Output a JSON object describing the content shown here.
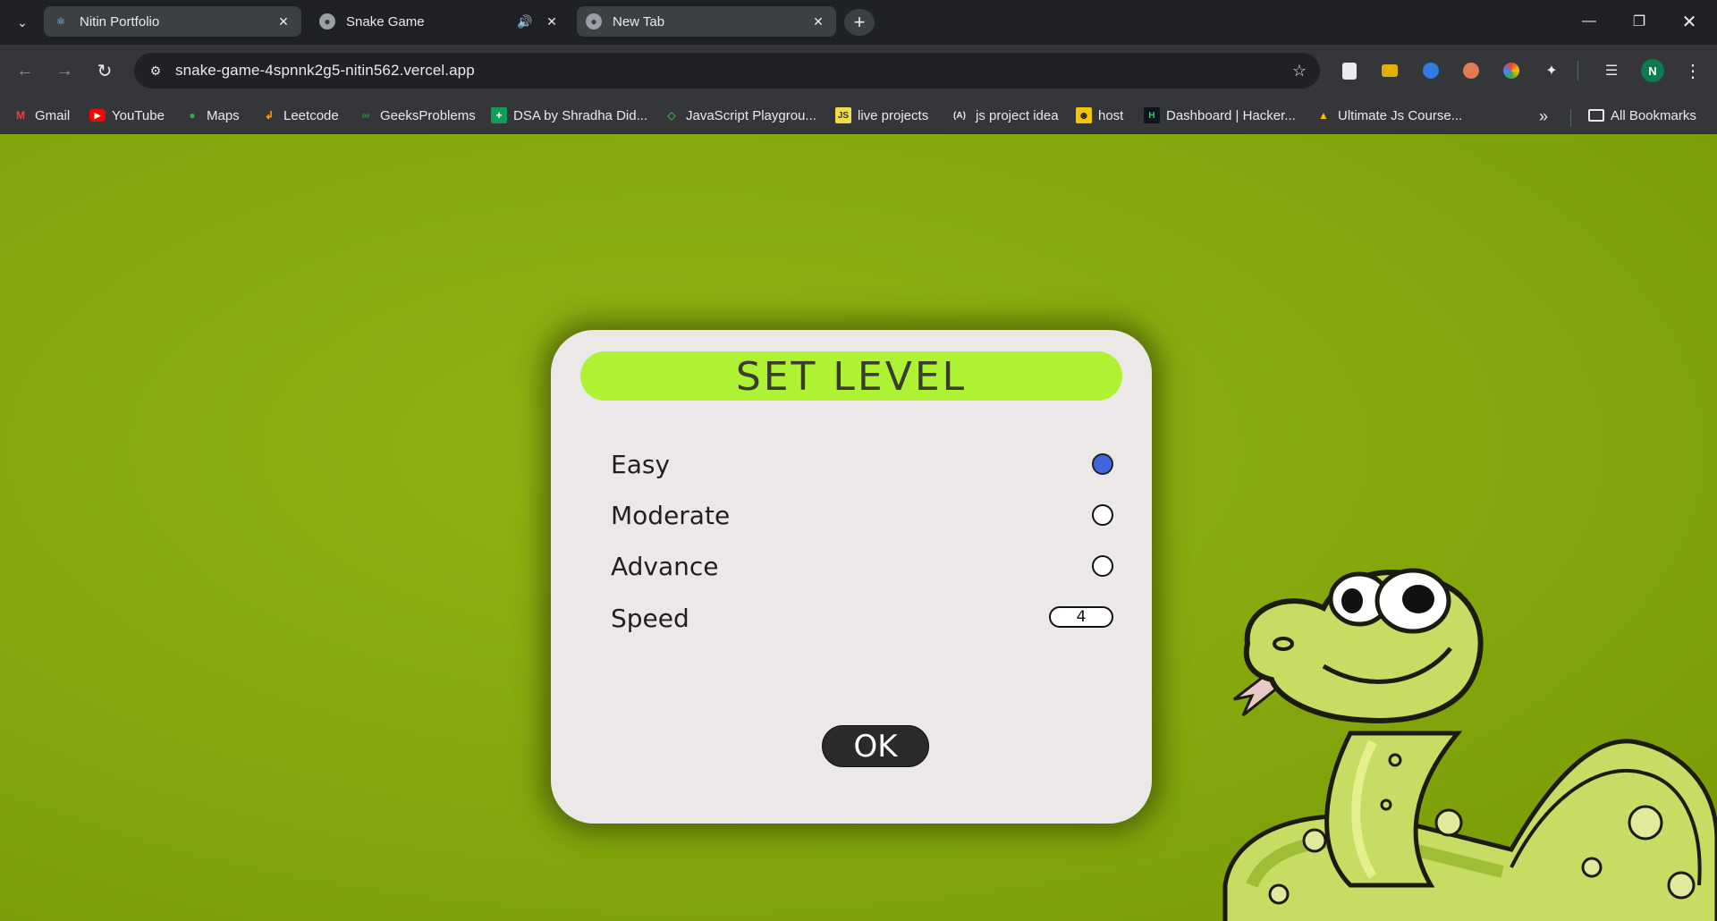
{
  "browser": {
    "tabs": [
      {
        "title": "Nitin Portfolio",
        "favicon": "react-icon"
      },
      {
        "title": "Snake Game",
        "favicon": "globe-icon",
        "audio": true
      },
      {
        "title": "New Tab",
        "favicon": "globe-icon"
      }
    ],
    "url": "snake-game-4spnnk2g5-nitin562.vercel.app",
    "profile_initial": "N",
    "bookmarks": [
      {
        "label": "Gmail",
        "icon": "gmail-icon"
      },
      {
        "label": "YouTube",
        "icon": "youtube-icon"
      },
      {
        "label": "Maps",
        "icon": "maps-icon"
      },
      {
        "label": "Leetcode",
        "icon": "leetcode-icon"
      },
      {
        "label": "GeeksProblems",
        "icon": "gfg-icon"
      },
      {
        "label": "DSA by Shradha Did...",
        "icon": "sheets-icon"
      },
      {
        "label": "JavaScript Playgrou...",
        "icon": "playground-icon"
      },
      {
        "label": "live projects",
        "icon": "js-icon",
        "icon_text": "JS"
      },
      {
        "label": "js project idea",
        "icon": "angular-icon",
        "icon_text": "(A)"
      },
      {
        "label": "host",
        "icon": "host-icon"
      },
      {
        "label": "Dashboard | Hacker...",
        "icon": "hackerrank-icon",
        "icon_text": "H"
      },
      {
        "label": "Ultimate Js Course...",
        "icon": "drive-icon"
      }
    ],
    "all_bookmarks_label": "All Bookmarks"
  },
  "dialog": {
    "title": "SET LEVEL",
    "options": [
      {
        "label": "Easy",
        "checked": true
      },
      {
        "label": "Moderate",
        "checked": false
      },
      {
        "label": "Advance",
        "checked": false
      }
    ],
    "speed_label": "Speed",
    "speed_value": "4",
    "ok_label": "OK"
  },
  "colors": {
    "background": "#86aa0d",
    "title_bar": "#aff233",
    "dialog": "#ede8e8",
    "radio_checked": "#3f67df",
    "ok_button": "#2a2a2a"
  }
}
